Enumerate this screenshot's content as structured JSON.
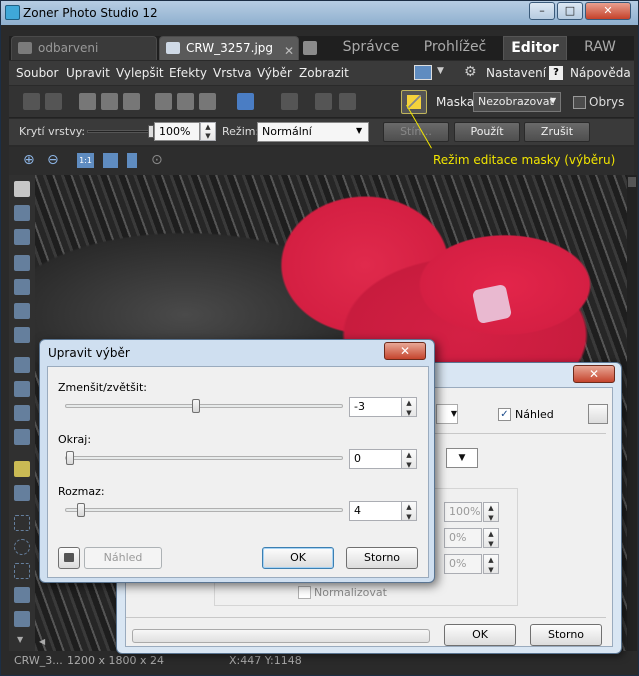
{
  "window": {
    "title": "Zoner Photo Studio 12",
    "caption_buttons": {
      "minimize": "–",
      "maximize": "□",
      "close": "✕"
    }
  },
  "tabs": {
    "documents": [
      {
        "label": "odbarveni"
      },
      {
        "label": "CRW_3257.jpg",
        "close": "✕"
      }
    ],
    "modes": [
      {
        "label": "Správce"
      },
      {
        "label": "Prohlížeč"
      },
      {
        "label": "Editor"
      },
      {
        "label": "RAW"
      }
    ]
  },
  "menu": {
    "items": [
      "Soubor",
      "Upravit",
      "Vylepšit",
      "Efekty",
      "Vrstva",
      "Výběr",
      "Zobrazit"
    ],
    "settings": "Nastavení",
    "help": "Nápověda",
    "help_icon": "?"
  },
  "toolbar": {
    "mask_label": "Maska:",
    "mask_value": "Nezobrazovat",
    "outline_label": "Obrys"
  },
  "options": {
    "opacity_label": "Krytí vrstvy:",
    "opacity_value": "100%",
    "opacity_fraction": 1.0,
    "mode_label": "Režim:",
    "mode_value": "Normální",
    "btn_stin": "Stín...",
    "btn_apply": "Použít",
    "btn_cancel": "Zrušit"
  },
  "zoom_tools": {
    "one_to_one": "1:1"
  },
  "annotation": "Režim editace masky (výběru)",
  "status": {
    "file": "CRW_3...",
    "dims": "1200 x 1800 x 24",
    "coords": "X:447  Y:1148"
  },
  "dialog_front": {
    "title": "Upravit výběr",
    "close": "✕",
    "shrink_grow_label": "Zmenšit/zvětšit:",
    "shrink_grow_value": "-3",
    "shrink_grow_fraction": 0.47,
    "edge_label": "Okraj:",
    "edge_value": "0",
    "edge_fraction": 0.0,
    "blur_label": "Rozmaz:",
    "blur_value": "4",
    "blur_fraction": 0.04,
    "preview_label": "Náhled",
    "ok_label": "OK",
    "cancel_label": "Storno"
  },
  "dialog_back": {
    "close": "✕",
    "preview_label": "Náhled",
    "spin1": "100%",
    "spin2": "0%",
    "spin3": "0%",
    "normalize_label": "Normalizovat",
    "ok_label": "OK",
    "cancel_label": "Storno"
  },
  "colors": {
    "accent_red": "#d51f43",
    "annotation": "#f1e500",
    "selection_pink": "#e9b9d0"
  }
}
